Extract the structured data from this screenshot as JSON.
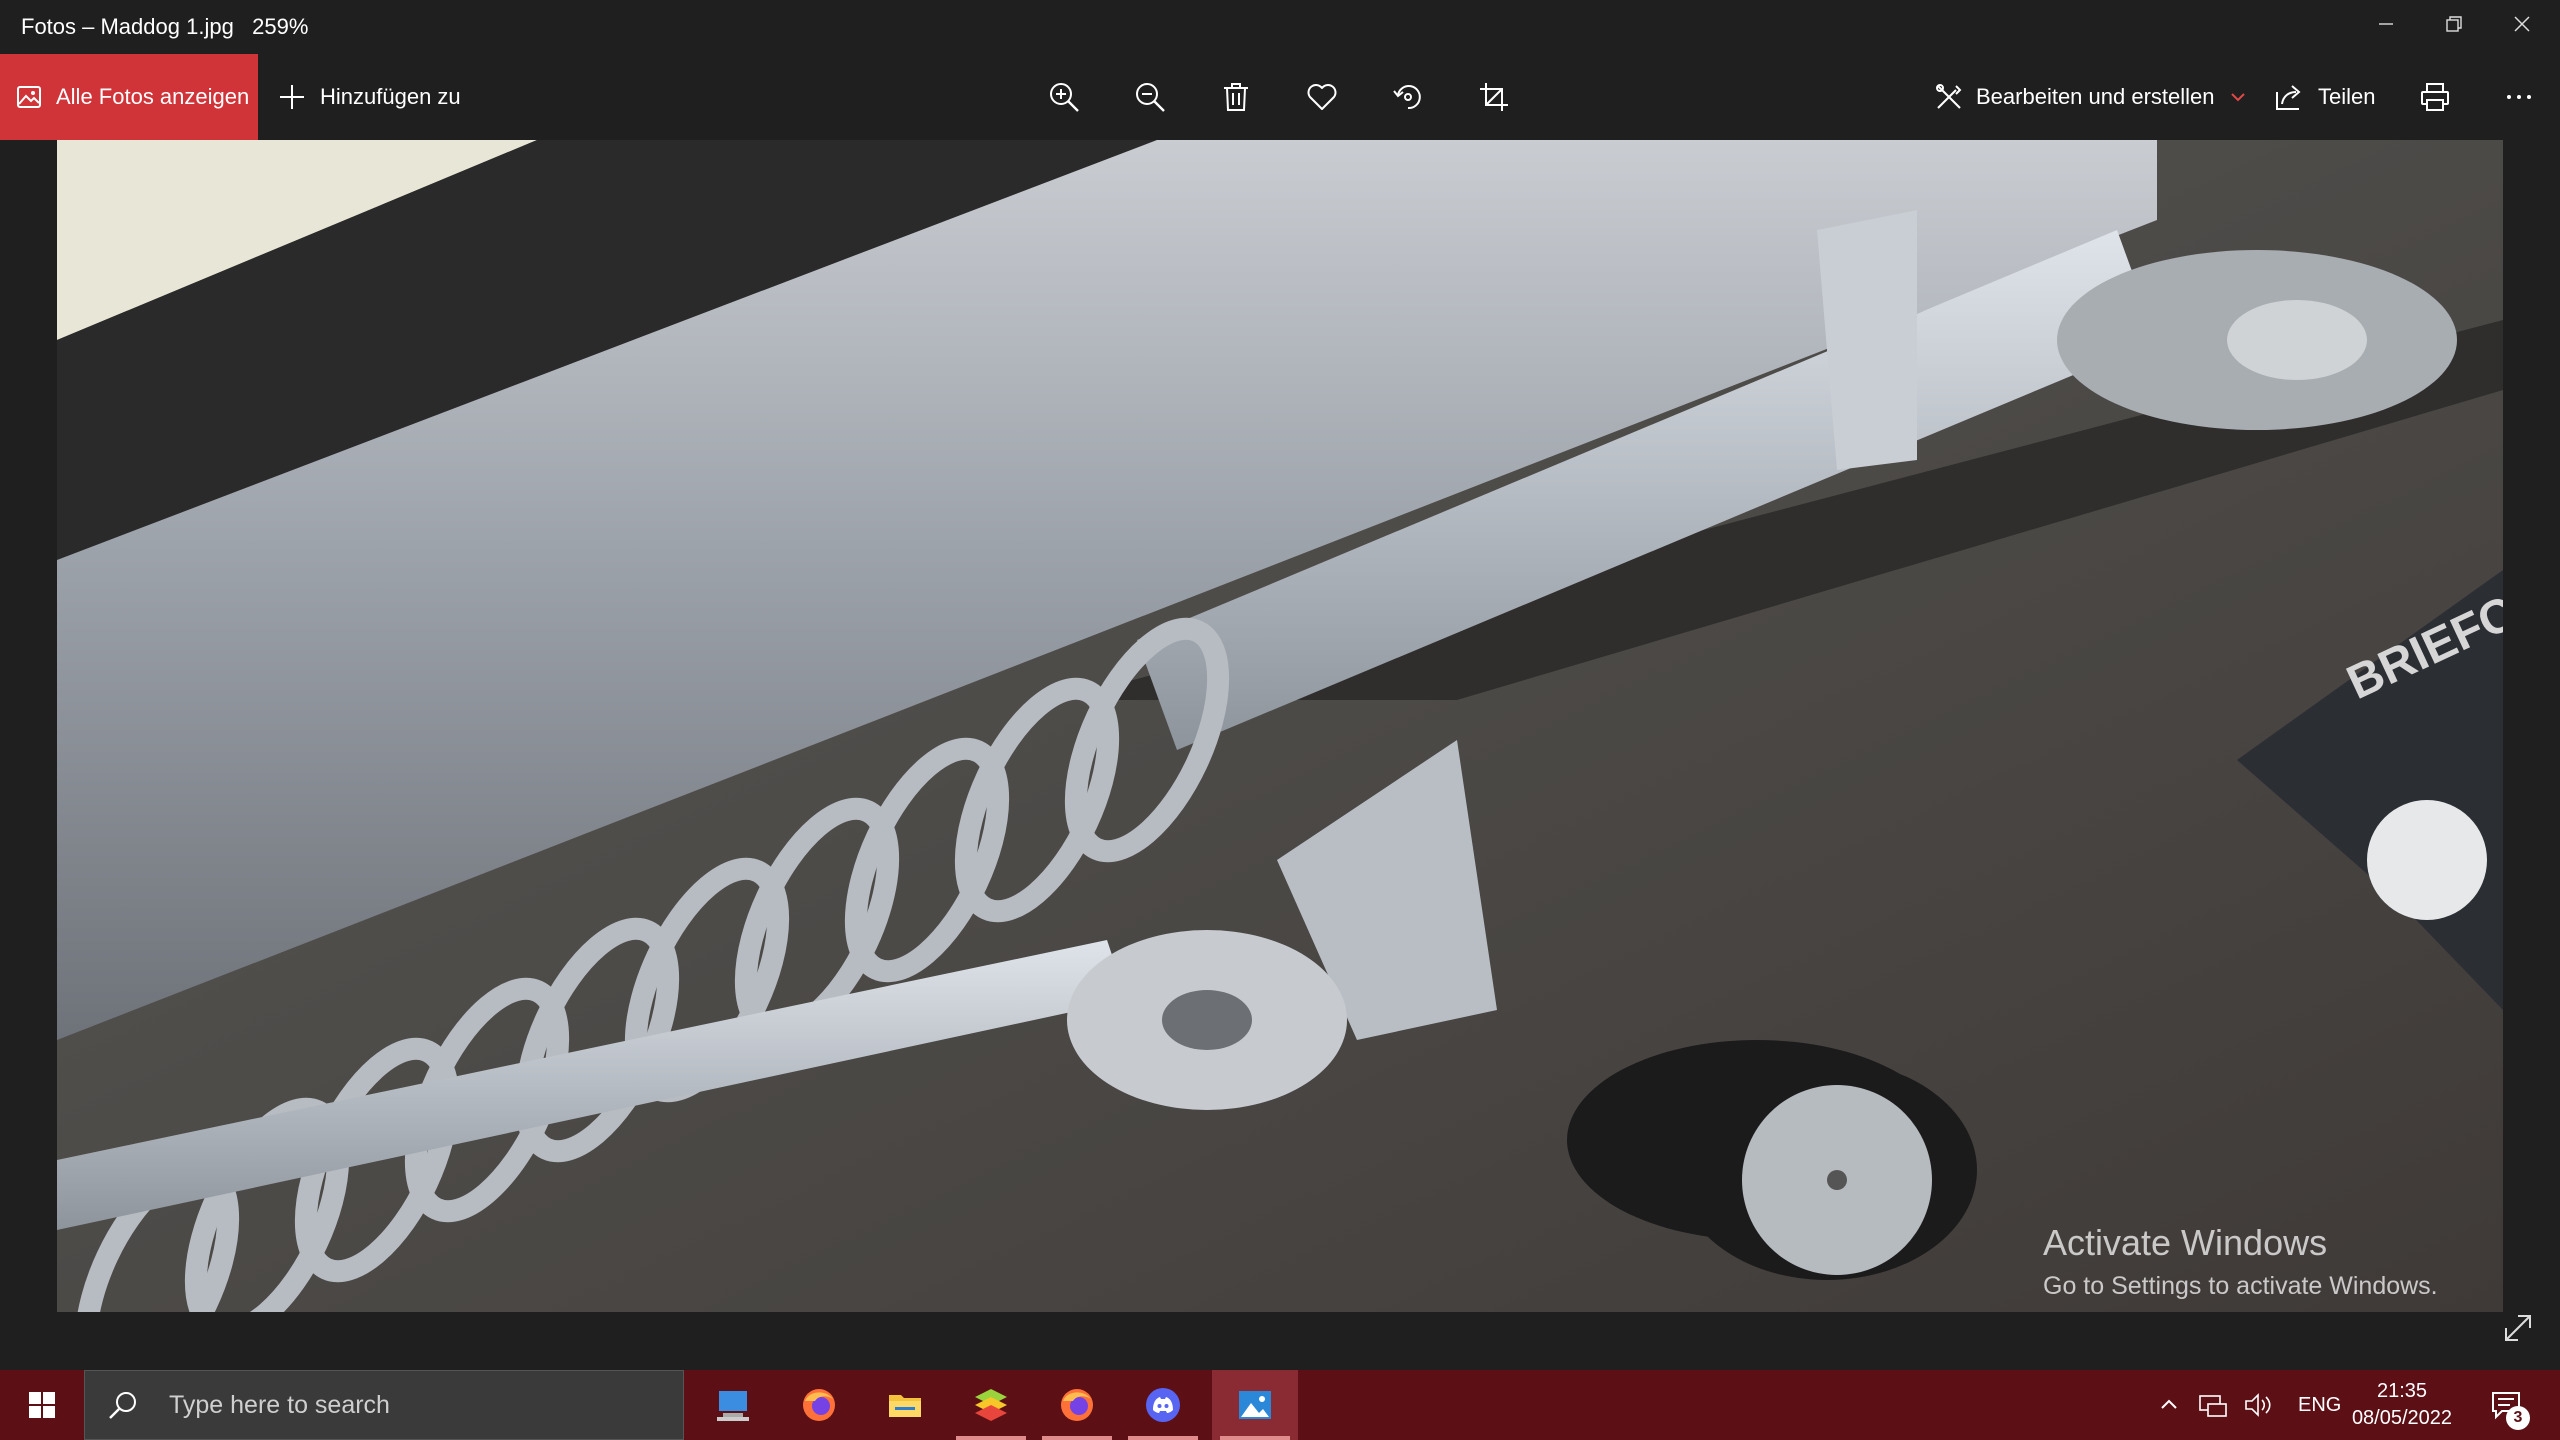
{
  "window": {
    "title": "Fotos – Maddog 1.jpg",
    "zoom": "259%"
  },
  "commandbar": {
    "all_photos_label": "Alle Fotos anzeigen",
    "add_to_label": "Hinzufügen zu",
    "tools": [
      "zoom-in-icon",
      "zoom-out-icon",
      "trash-icon",
      "heart-icon",
      "rotate-icon",
      "crop-icon"
    ],
    "edit_label": "Bearbeiten und erstellen",
    "share_label": "Teilen",
    "accent_color": "#d13438"
  },
  "photo": {
    "visible_text": "BRIEFCASE"
  },
  "watermark": {
    "line1": "Activate Windows",
    "line2": "Go to Settings to activate Windows."
  },
  "taskbar": {
    "search_placeholder": "Type here to search",
    "apps": [
      "desktop-app",
      "firefox",
      "file-explorer",
      "bluestacks",
      "firefox",
      "discord",
      "photos"
    ],
    "language": "ENG",
    "time": "21:35",
    "date": "08/05/2022",
    "notification_count": "3",
    "color": "#5c1016"
  }
}
